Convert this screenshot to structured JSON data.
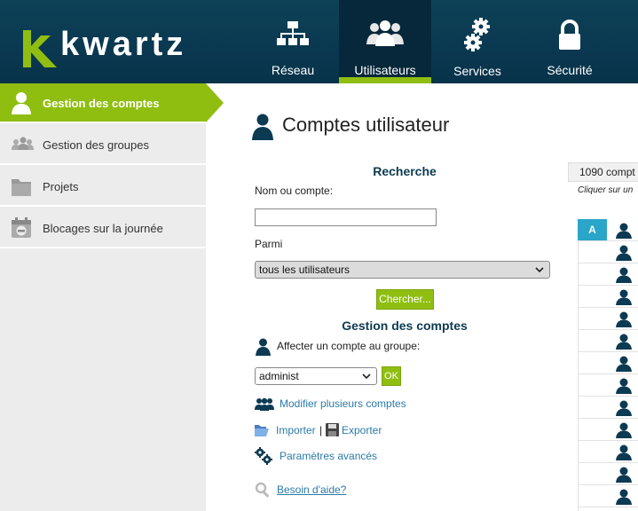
{
  "header": {
    "logo_text": "kwartz",
    "nav": [
      {
        "label": "Réseau",
        "icon": "network-icon",
        "active": false
      },
      {
        "label": "Utilisateurs",
        "icon": "users-icon",
        "active": true
      },
      {
        "label": "Services",
        "icon": "gears-icon",
        "active": false
      },
      {
        "label": "Sécurité",
        "icon": "lock-icon",
        "active": false
      }
    ]
  },
  "sidebar": {
    "items": [
      {
        "label": "Gestion des comptes",
        "icon": "user-icon",
        "active": true
      },
      {
        "label": "Gestion des groupes",
        "icon": "group-icon",
        "active": false
      },
      {
        "label": "Projets",
        "icon": "folder-icon",
        "active": false
      },
      {
        "label": "Blocages sur la journée",
        "icon": "calendar-block-icon",
        "active": false
      }
    ]
  },
  "main": {
    "title": "Comptes utilisateur",
    "search": {
      "title": "Recherche",
      "name_label": "Nom ou compte:",
      "name_value": "",
      "among_label": "Parmi",
      "among_selected": "tous les utilisateurs",
      "search_button": "Chercher..."
    },
    "management": {
      "title": "Gestion des comptes",
      "assign_label": "Affecter un compte au groupe:",
      "group_selected": "administ",
      "ok_button": "OK",
      "modify_multiple": "Modifier plusieurs comptes",
      "import": "Importer",
      "separator": "|",
      "export": "Exporter",
      "advanced": "Paramètres avancés",
      "help": "Besoin d'aide?"
    }
  },
  "results": {
    "count_text": "1090 compt",
    "hint": "Cliquer sur un",
    "letter": "A",
    "row_count": 13
  },
  "colors": {
    "header_bg": "#0a3850",
    "accent_green": "#8fbe11",
    "link_blue": "#2a7ba8",
    "letter_blue": "#29a6c9"
  }
}
